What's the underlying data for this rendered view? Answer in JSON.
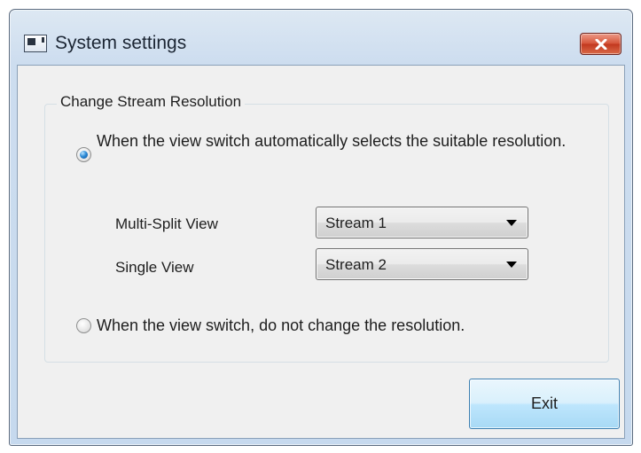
{
  "window": {
    "title": "System settings",
    "close_icon": "close-x-icon",
    "app_icon": "window-app-icon"
  },
  "group": {
    "label": "Change Stream Resolution",
    "option_auto": {
      "label": "When the view switch automatically selects the suitable resolution.",
      "checked": true
    },
    "multi_split": {
      "label": "Multi-Split View",
      "value": "Stream 1"
    },
    "single": {
      "label": "Single View",
      "value": "Stream 2"
    },
    "option_keep": {
      "label": "When the view switch, do not change the resolution.",
      "checked": false
    }
  },
  "buttons": {
    "exit": "Exit"
  },
  "colors": {
    "close_button": "#c7432a",
    "exit_button": "#bee6fd",
    "radio_selected": "#1f6fc2"
  }
}
